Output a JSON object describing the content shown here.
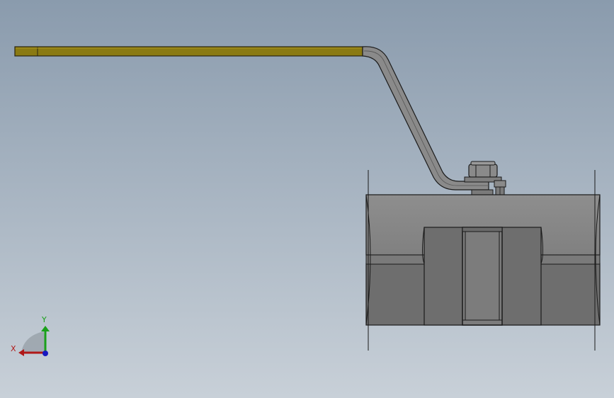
{
  "app": {
    "view": "cad-3d-viewport",
    "model": "ball-valve"
  },
  "colors": {
    "background_top": "#8a9bad",
    "background_bottom": "#c8d0d8",
    "handle_grip": "#8a7a12",
    "handle_grip_edge": "#2a2510",
    "lever_steel": "#8a8a8a",
    "body_light": "#8c8c8c",
    "body_dark": "#6e6e6e",
    "body_mid": "#7a7a7a",
    "outline": "#1a1a1a",
    "axis_x": "#b01818",
    "axis_y": "#1aa01a",
    "axis_z": "#1818c0"
  },
  "triad": {
    "x_label": "X",
    "y_label": "Y"
  }
}
